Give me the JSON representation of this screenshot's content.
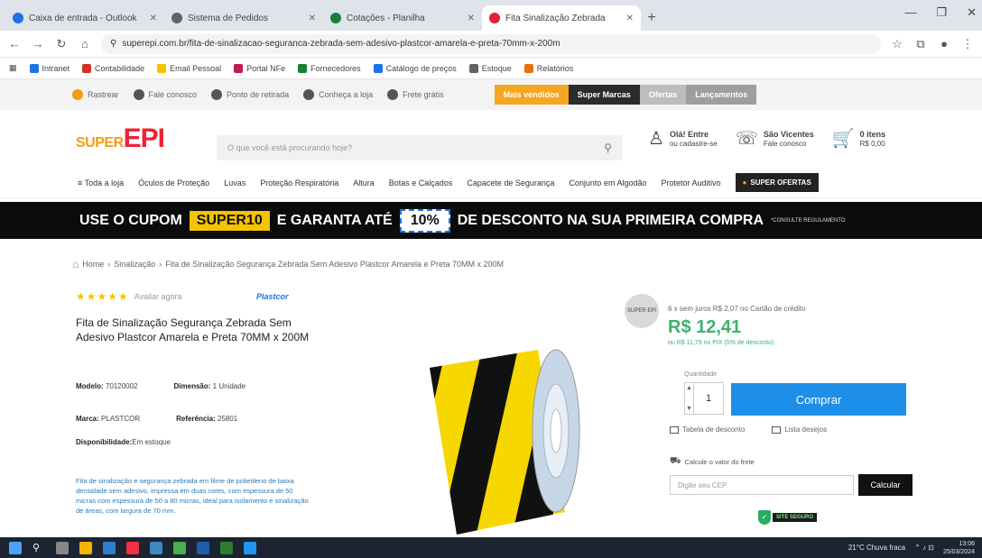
{
  "browser": {
    "tabs": [
      {
        "title": "Caixa de entrada - Outlook",
        "active": false
      },
      {
        "title": "Sistema de Pedidos",
        "active": false
      },
      {
        "title": "Cotações - Planilha",
        "active": false
      },
      {
        "title": "Fita Sinalização Zebrada",
        "active": true
      }
    ],
    "url": "superepi.com.br/fita-de-sinalizacao-seguranca-zebrada-sem-adesivo-plastcor-amarela-e-preta-70mm-x-200m",
    "bookmarks": [
      {
        "label": "Intranet",
        "color": "#1a73e8"
      },
      {
        "label": "Contabilidade",
        "color": "#d93025"
      },
      {
        "label": "Email Pessoal",
        "color": "#f5c400"
      },
      {
        "label": "Portal NFe",
        "color": "#c2185b"
      },
      {
        "label": "Fornecedores",
        "color": "#188038"
      },
      {
        "label": "Catálogo de preços",
        "color": "#1a73e8"
      },
      {
        "label": "Estoque",
        "color": "#5f6368"
      },
      {
        "label": "Relatórios",
        "color": "#e8710a"
      }
    ]
  },
  "site": {
    "top_links": [
      "Rastrear",
      "Fale conosco",
      "Ponto de retirada",
      "Conheça a loja",
      "Frete grátis"
    ],
    "top_segments": [
      {
        "label": "Mais vendidos",
        "color": "#f5a623"
      },
      {
        "label": "Super Marcas",
        "color": "#2b2b2b"
      },
      {
        "label": "Ofertas",
        "color": "#bdbdbd"
      },
      {
        "label": "Lançamentos",
        "color": "#9e9e9e"
      }
    ],
    "logo": {
      "prefix": "SUPER",
      "main": "EPI"
    },
    "search_placeholder": "O que você está procurando hoje?",
    "account": {
      "line1": "Olá! Entre",
      "line2": "ou cadastre-se"
    },
    "service": {
      "line1": "São Vicentes",
      "line2": "Fale conosco"
    },
    "cart": {
      "line1": "0 itens",
      "line2": "R$ 0,00"
    },
    "categories": [
      "Toda a loja",
      "Óculos de Proteção",
      "Luvas",
      "Proteção Respiratória",
      "Altura",
      "Botas e Calçados",
      "Capacete de Segurança",
      "Conjunto em Algodão",
      "Protetor Auditivo"
    ],
    "category_promo": "SUPER OFERTAS"
  },
  "promo": {
    "text1": "USE O CUPOM",
    "code": "SUPER10",
    "text2": "E GARANTA ATÉ",
    "percent": "10%",
    "text3": "DE DESCONTO NA SUA PRIMEIRA COMPRA",
    "small": "*CONSULTE REGULAMENTO"
  },
  "breadcrumb": {
    "items": [
      "Home",
      "Sinalização"
    ],
    "current": "Fita de Sinalização Segurança Zebrada Sem Adesivo Plastcor Amarela e Preta 70MM x 200M"
  },
  "product": {
    "stars": "★★★★★",
    "review_link": "Avaliar agora",
    "brand": "Plastcor",
    "title": "Fita de Sinalização Segurança Zebrada Sem Adesivo Plastcor Amarela e Preta 70MM x 200M",
    "model_label": "Modelo:",
    "model_value": "70120002",
    "dimension_label": "Dimensão:",
    "dimension_value": "1 Unidade",
    "brand_label": "Marca:",
    "brand_value": "PLASTCOR",
    "reference_label": "Referência:",
    "reference_value": "25801",
    "availability_label": "Disponibilidade:",
    "availability_value": "Em estoque",
    "description": "Fita de sinalização e segurança zebrada em filme de polietileno de baixa densidade sem adesivo, impressa em duas cores, com espessura de 50 micras com espessura de 50 a 80 micras, ideal para isolamento e sinalização de áreas, com largura de 70 mm."
  },
  "buy": {
    "seller_badge": "SUPER EPI",
    "installments": "6 x sem juros R$ 2,07 no Cartão de crédito",
    "price": "R$ 12,41",
    "pix": "ou R$ 11,79 no PIX (5% de desconto)",
    "qty_label": "Quantidade",
    "qty_value": "1",
    "buy_label": "Comprar",
    "link1": "Tabela de desconto",
    "link2": "Lista desejos",
    "ship_label": "Calcule o valor do frete",
    "cep_placeholder": "Digite seu CEP",
    "cep_button": "Calcular",
    "secure_label": "SITE SEGURO"
  },
  "taskbar": {
    "weather": "21°C Chuva fraca",
    "time": "13:06",
    "date": "25/03/2024"
  },
  "colors": {
    "brand_red": "#e22233",
    "brand_orange": "#f39c12",
    "buy_blue": "#1e8fe8",
    "price_green": "#3cb371",
    "promo_yellow": "#f5c400"
  }
}
